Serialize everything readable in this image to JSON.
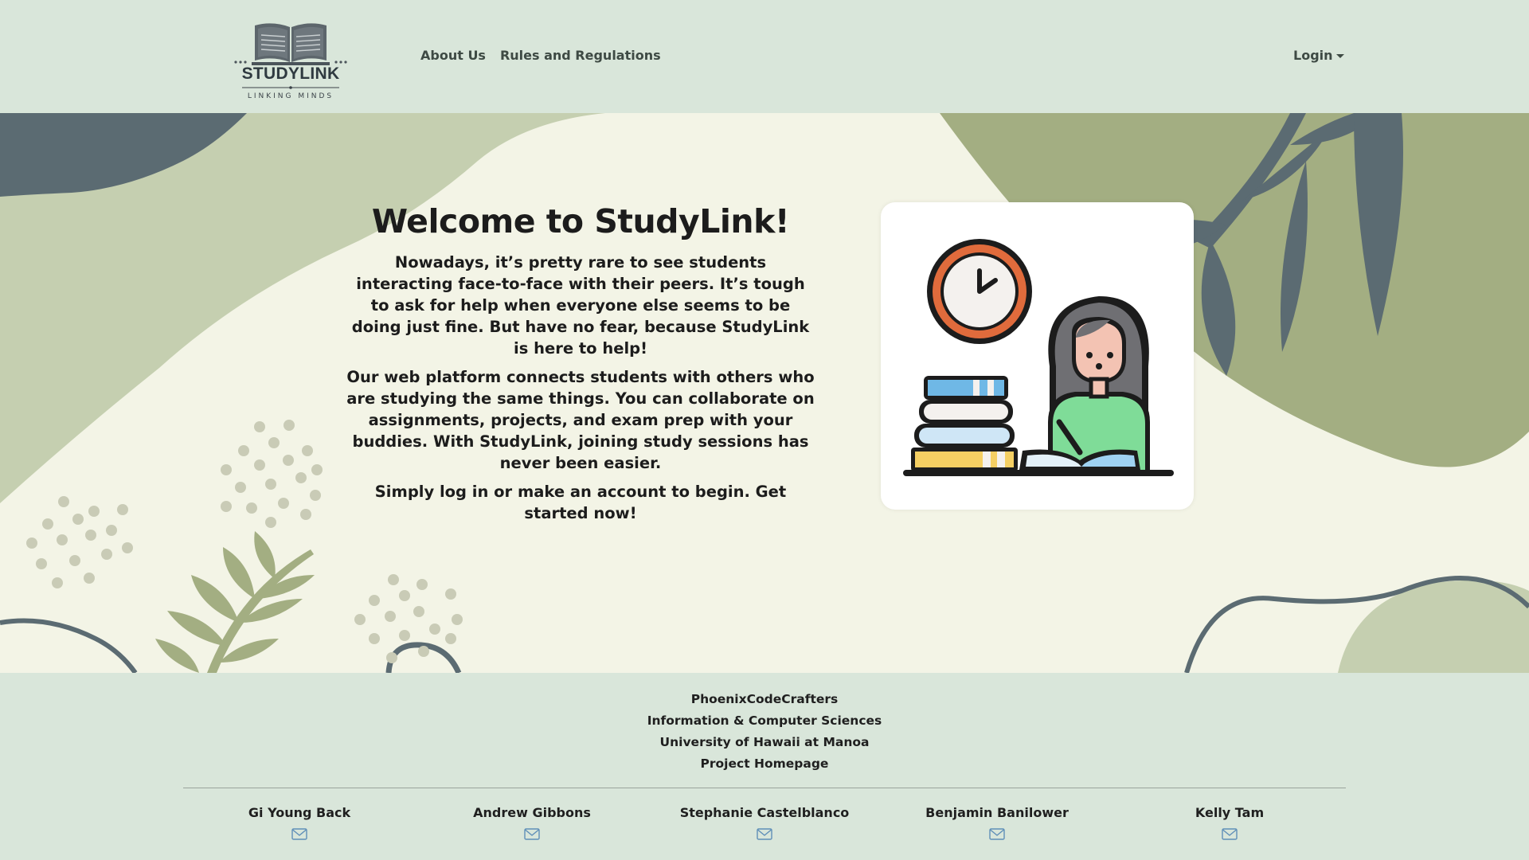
{
  "navbar": {
    "logo": {
      "title": "STUDYLINK",
      "subtitle": "LINKING MINDS"
    },
    "links": [
      {
        "label": "About Us"
      },
      {
        "label": "Rules and Regulations"
      }
    ],
    "login_label": "Login"
  },
  "hero": {
    "title": "Welcome to StudyLink!",
    "paragraphs": [
      "Nowadays, it’s pretty rare to see students interacting face-to-face with their peers. It’s tough to ask for help when everyone else seems to be doing just fine. But have no fear, because StudyLink is here to help!",
      "Our web platform connects students with others who are studying the same things. You can collaborate on assignments, projects, and exam prep with your buddies. With StudyLink, joining study sessions has never been easier.",
      "Simply log in or make an account to begin. Get started now!"
    ],
    "illustration_icon": "student-studying-illustration"
  },
  "footer": {
    "org": "PhoenixCodeCrafters",
    "department": "Information & Computer Sciences",
    "university": "University of Hawaii at Manoa",
    "homepage_label": "Project Homepage",
    "team": [
      {
        "name": "Gi Young Back",
        "icon": "mail-icon"
      },
      {
        "name": "Andrew Gibbons",
        "icon": "mail-icon"
      },
      {
        "name": "Stephanie Castelblanco",
        "icon": "mail-icon"
      },
      {
        "name": "Benjamin Banilower",
        "icon": "mail-icon"
      },
      {
        "name": "Kelly Tam",
        "icon": "mail-icon"
      }
    ]
  },
  "colors": {
    "nav_bg": "#d9e6da",
    "hero_cream": "#f3f4e6",
    "sage": "#a3ae82",
    "light_sage": "#c5cfb0",
    "slate": "#5b6b72"
  }
}
